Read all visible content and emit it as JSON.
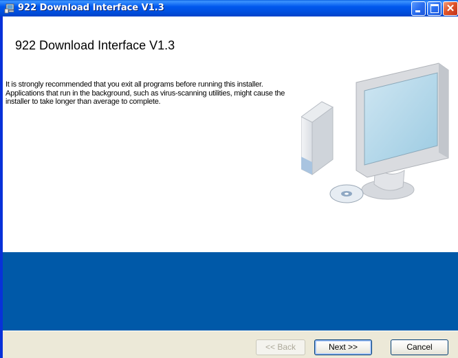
{
  "window": {
    "title": "922 Download Interface V1.3",
    "icon": "installer-computer-icon"
  },
  "titlebar_buttons": {
    "minimize": "minimize-icon",
    "maximize": "maximize-icon",
    "close": "close-icon"
  },
  "main": {
    "heading": "922 Download Interface V1.3",
    "body": "It is strongly recommended that you exit all programs before running this installer. Applications that run in the background, such as virus-scanning utilities, might cause the installer to take longer than average to complete."
  },
  "buttons": {
    "back_label": "<< Back",
    "back_enabled": false,
    "next_label": "Next >>",
    "cancel_label": "Cancel"
  },
  "colors": {
    "titlebar": "#0058ee",
    "band": "#0059a8",
    "footer": "#ece9d8"
  }
}
